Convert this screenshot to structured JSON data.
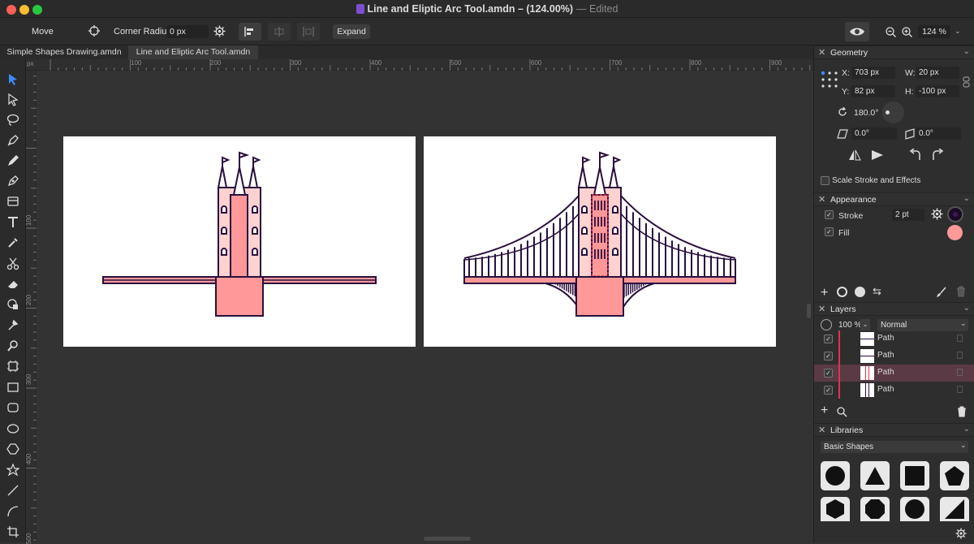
{
  "window": {
    "title": "Line and Eliptic Arc Tool.amdn – (124.00%)",
    "edited": "— Edited"
  },
  "toolbar": {
    "tool_name": "Move",
    "corner_radius_label": "Corner Radius:",
    "corner_radius_value": "0 px",
    "expand_label": "Expand",
    "zoom_value": "124 %"
  },
  "tabs": [
    {
      "label": "Simple Shapes Drawing.amdn"
    },
    {
      "label": "Line and Eliptic Arc Tool.amdn"
    }
  ],
  "rulers": {
    "h_ticks": [
      "px",
      "100",
      "200",
      "300",
      "400",
      "500",
      "600",
      "700",
      "800",
      "900"
    ],
    "v_ticks": [
      "100",
      "200",
      "300",
      "400",
      "500"
    ]
  },
  "geometry": {
    "header": "Geometry",
    "x_label": "X:",
    "x_value": "703 px",
    "w_label": "W:",
    "w_value": "20 px",
    "y_label": "Y:",
    "y_value": "82 px",
    "h_label": "H:",
    "h_value": "-100 px",
    "rotation": "180.0°",
    "skew_x": "0.0°",
    "skew_y": "0.0°",
    "scale_stroke_label": "Scale Stroke and Effects"
  },
  "appearance": {
    "header": "Appearance",
    "stroke_label": "Stroke",
    "stroke_value": "2 pt",
    "stroke_color": "#2a0f3d",
    "fill_label": "Fill",
    "fill_color": "#ff9999"
  },
  "layers": {
    "header": "Layers",
    "opacity": "100 %",
    "blend_mode": "Normal",
    "items": [
      {
        "name": "Path",
        "selected": false
      },
      {
        "name": "Path",
        "selected": false
      },
      {
        "name": "Path",
        "selected": true
      },
      {
        "name": "Path",
        "selected": false
      }
    ]
  },
  "libraries": {
    "header": "Libraries",
    "set": "Basic Shapes",
    "shapes": [
      "circle-shape",
      "triangle-shape",
      "square-shape",
      "pentagon-shape",
      "hexagon-shape",
      "octagon-shape",
      "nonagon-shape",
      "right-triangle-shape"
    ]
  },
  "colors": {
    "accent_pink": "#ff9999",
    "outline": "#2a0f3d",
    "selection": "#e0334f"
  }
}
